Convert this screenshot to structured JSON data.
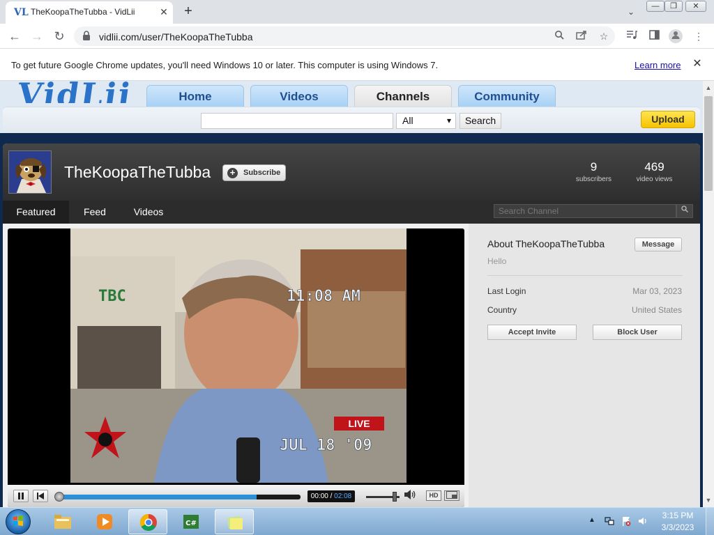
{
  "browser": {
    "tab_title": "TheKoopaTheTubba - VidLii",
    "tab_favicon": "VL",
    "tab_close": "✕",
    "new_tab": "+",
    "tab_search": "⌄",
    "url": "vidlii.com/user/TheKoopaTheTubba",
    "window_buttons": {
      "minimize": "—",
      "maximize": "❐",
      "close": "✕"
    },
    "nav": {
      "back": "←",
      "forward": "→",
      "reload": "↻"
    },
    "icons": [
      "lock-icon",
      "zoom-icon",
      "share-icon",
      "star-icon",
      "media-icon",
      "side-panel-icon",
      "profile-icon",
      "menu-icon"
    ]
  },
  "infobar": {
    "message": "To get future Google Chrome updates, you'll need Windows 10 or later. This computer is using Windows 7.",
    "learn_more": "Learn more",
    "close": "✕"
  },
  "site": {
    "logo": "VidLii",
    "nav": {
      "home": "Home",
      "videos": "Videos",
      "channels": "Channels",
      "community": "Community"
    },
    "search_input_value": "",
    "search_select": "All",
    "search_button": "Search",
    "upload_button": "Upload"
  },
  "channel": {
    "name": "TheKoopaTheTubba",
    "subscribe": "Subscribe",
    "subscribers_count": "9",
    "subscribers_label": "subscribers",
    "views_count": "469",
    "views_label": "video views",
    "tabs": {
      "featured": "Featured",
      "feed": "Feed",
      "videos": "Videos"
    },
    "search_placeholder": "Search Channel"
  },
  "player": {
    "time_current": "00:00",
    "time_separator": " / ",
    "time_duration": "02:08",
    "progress_fraction": 0.82,
    "volume_fraction": 0.9,
    "hd_label": "HD",
    "overlay_text": {
      "station": "TBC",
      "time": "11:08 AM",
      "date": "JUL 18 '09",
      "live": "LIVE"
    }
  },
  "about": {
    "title": "About TheKoopaTheTubba",
    "message_button": "Message",
    "bio": "Hello",
    "last_login_label": "Last Login",
    "last_login_value": "Mar 03, 2023",
    "country_label": "Country",
    "country_value": "United States",
    "accept_invite": "Accept Invite",
    "block_user": "Block User"
  },
  "taskbar": {
    "clock_time": "3:15 PM",
    "clock_date": "3/3/2023",
    "csharp_label": "C#",
    "tray_arrow": "▲"
  },
  "colors": {
    "upload_yellow": "#f5c400",
    "nav_blue": "#1f4f8f",
    "seek_blue": "#2d8fd6",
    "channel_dark": "#2e2e2e"
  }
}
